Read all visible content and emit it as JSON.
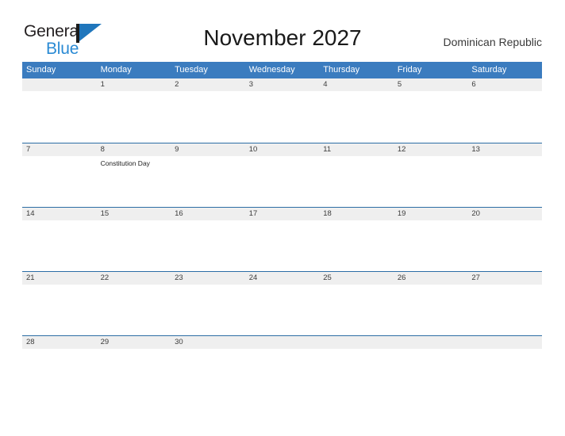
{
  "brand": {
    "name_part1": "General",
    "name_part2": "Blue",
    "flag_icon": "flag-icon",
    "accent_color": "#2a8ad4"
  },
  "header": {
    "title": "November 2027",
    "country": "Dominican Republic"
  },
  "calendar": {
    "header_color": "#3b7cbf",
    "band_color": "#efefef",
    "rule_color": "#2c6da5",
    "weekdays": [
      "Sunday",
      "Monday",
      "Tuesday",
      "Wednesday",
      "Thursday",
      "Friday",
      "Saturday"
    ],
    "weeks": [
      [
        {
          "day": "",
          "events": []
        },
        {
          "day": "1",
          "events": []
        },
        {
          "day": "2",
          "events": []
        },
        {
          "day": "3",
          "events": []
        },
        {
          "day": "4",
          "events": []
        },
        {
          "day": "5",
          "events": []
        },
        {
          "day": "6",
          "events": []
        }
      ],
      [
        {
          "day": "7",
          "events": []
        },
        {
          "day": "8",
          "events": [
            "Constitution Day"
          ]
        },
        {
          "day": "9",
          "events": []
        },
        {
          "day": "10",
          "events": []
        },
        {
          "day": "11",
          "events": []
        },
        {
          "day": "12",
          "events": []
        },
        {
          "day": "13",
          "events": []
        }
      ],
      [
        {
          "day": "14",
          "events": []
        },
        {
          "day": "15",
          "events": []
        },
        {
          "day": "16",
          "events": []
        },
        {
          "day": "17",
          "events": []
        },
        {
          "day": "18",
          "events": []
        },
        {
          "day": "19",
          "events": []
        },
        {
          "day": "20",
          "events": []
        }
      ],
      [
        {
          "day": "21",
          "events": []
        },
        {
          "day": "22",
          "events": []
        },
        {
          "day": "23",
          "events": []
        },
        {
          "day": "24",
          "events": []
        },
        {
          "day": "25",
          "events": []
        },
        {
          "day": "26",
          "events": []
        },
        {
          "day": "27",
          "events": []
        }
      ],
      [
        {
          "day": "28",
          "events": []
        },
        {
          "day": "29",
          "events": []
        },
        {
          "day": "30",
          "events": []
        },
        {
          "day": "",
          "events": []
        },
        {
          "day": "",
          "events": []
        },
        {
          "day": "",
          "events": []
        },
        {
          "day": "",
          "events": []
        }
      ]
    ]
  }
}
